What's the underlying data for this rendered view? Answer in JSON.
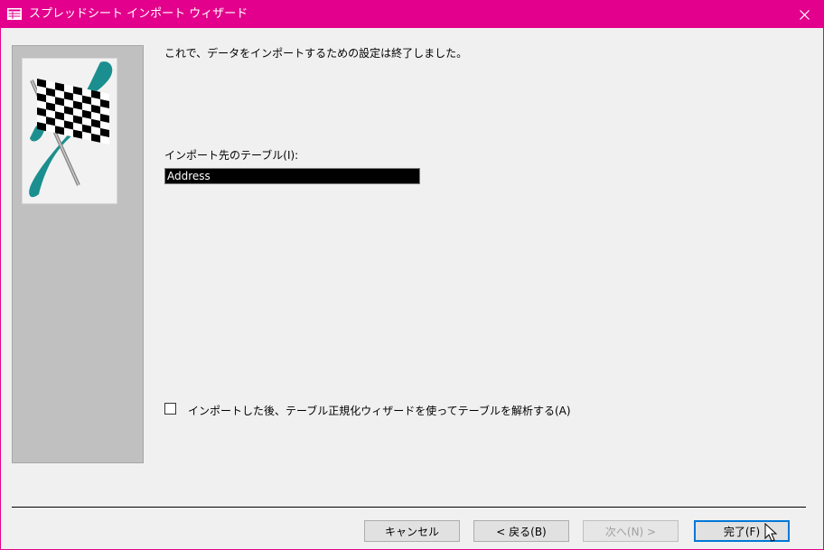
{
  "window": {
    "title": "スプレッドシート インポート ウィザード",
    "accent_color": "#e3008c",
    "title_icon": "table-icon",
    "close_icon": "close-icon"
  },
  "main": {
    "finish_message": "これで、データをインポートするための設定は終了しました。",
    "table_label": "インポート先のテーブル(I):",
    "table_value": "Address",
    "analyze_checkbox": {
      "label": "インポートした後、テーブル正規化ウィザードを使ってテーブルを解析する(A)",
      "checked": false
    }
  },
  "side_panel": {
    "image": "checkered-flag-icon"
  },
  "buttons": {
    "cancel": "キャンセル",
    "back": "< 戻る(B)",
    "next": "次へ(N) >",
    "finish": "完了(F)"
  }
}
